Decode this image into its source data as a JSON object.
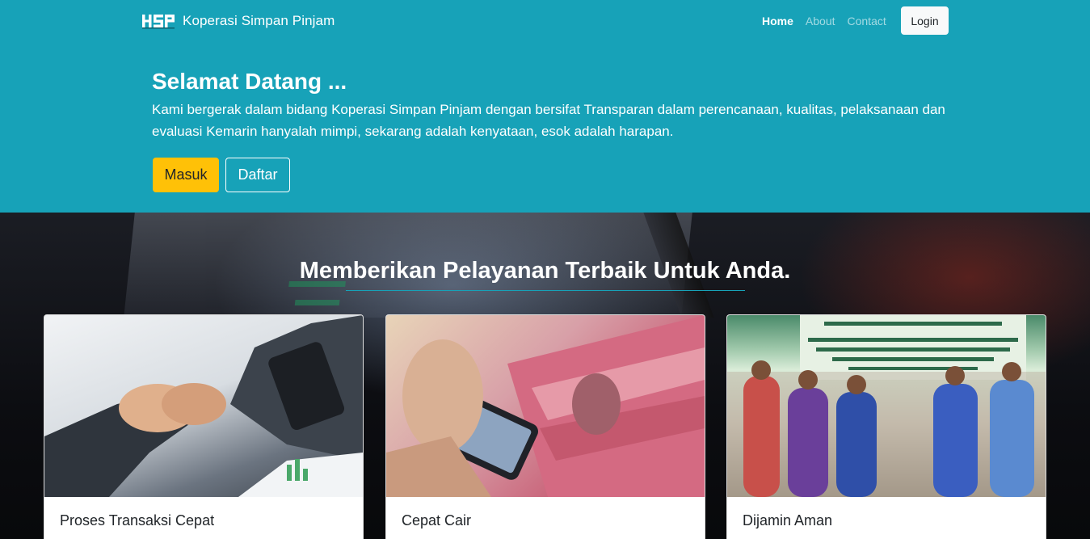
{
  "brand": {
    "logo_text": "HSP",
    "name": "Koperasi Simpan Pinjam"
  },
  "nav": {
    "items": [
      {
        "label": "Home",
        "active": true
      },
      {
        "label": "About",
        "active": false
      },
      {
        "label": "Contact",
        "active": false
      }
    ],
    "login_label": "Login"
  },
  "hero": {
    "title": "Selamat Datang ...",
    "text": "Kami bergerak dalam bidang Koperasi Simpan Pinjam dengan bersifat Transparan dalam perencanaan, kualitas, pelaksanaan dan evaluasi Kemarin hanyalah mimpi, sekarang adalah kenyataan, esok adalah harapan.",
    "primary_button": "Masuk",
    "secondary_button": "Daftar"
  },
  "services": {
    "title": "Memberikan Pelayanan Terbaik Untuk Anda.",
    "cards": [
      {
        "title": "Proses Transaksi Cepat",
        "image": "handshake-photo"
      },
      {
        "title": "Cepat Cair",
        "image": "money-phone-photo"
      },
      {
        "title": "Dijamin Aman",
        "image": "ceremony-photo"
      }
    ]
  },
  "colors": {
    "primary": "#17a2b8",
    "warning": "#ffc107",
    "light": "#f8f9fa"
  }
}
